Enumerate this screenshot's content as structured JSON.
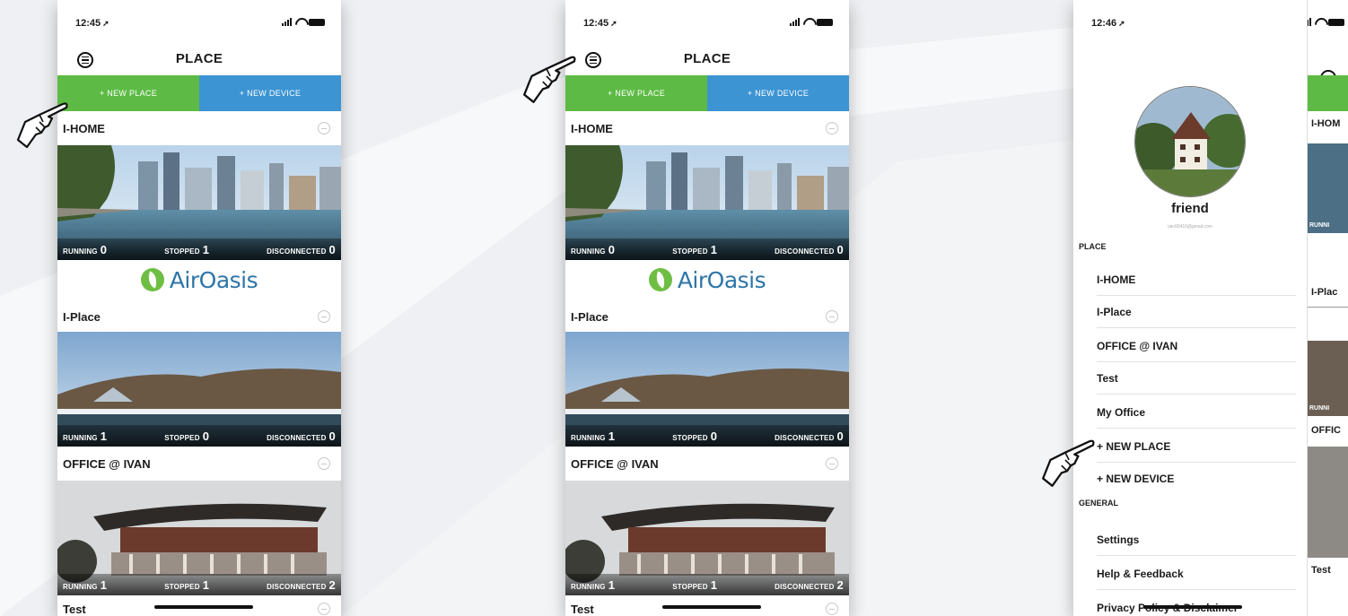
{
  "colors": {
    "green": "#5dbb45",
    "blue": "#3c94d3",
    "logo_blue": "#2e75a8",
    "leaf_green": "#6fbe44"
  },
  "screen1": {
    "time": "12:45",
    "title": "PLACE",
    "new_place": "+ NEW PLACE",
    "new_device": "+ NEW DEVICE",
    "places": [
      {
        "name": "I-HOME",
        "running": "0",
        "stopped": "1",
        "disconnected": "0"
      },
      {
        "name": "I-Place",
        "running": "1",
        "stopped": "0",
        "disconnected": "0"
      },
      {
        "name": "OFFICE @ IVAN",
        "running": "1",
        "stopped": "1",
        "disconnected": "2"
      },
      {
        "name": "Test"
      }
    ],
    "labels": {
      "running": "RUNNING",
      "stopped": "STOPPED",
      "disconnected": "DISCONNECTED"
    },
    "logo": "AirOasis"
  },
  "screen2": {
    "time": "12:45",
    "title": "PLACE",
    "new_place": "+ NEW PLACE",
    "new_device": "+ NEW DEVICE",
    "places": [
      {
        "name": "I-HOME",
        "running": "0",
        "stopped": "1",
        "disconnected": "0"
      },
      {
        "name": "I-Place",
        "running": "1",
        "stopped": "0",
        "disconnected": "0"
      },
      {
        "name": "OFFICE @ IVAN",
        "running": "1",
        "stopped": "1",
        "disconnected": "2"
      },
      {
        "name": "Test"
      }
    ],
    "labels": {
      "running": "RUNNING",
      "stopped": "STOPPED",
      "disconnected": "DISCONNECTED"
    },
    "logo": "AirOasis"
  },
  "screen3": {
    "time": "12:46",
    "profile_name": "friend",
    "profile_email": "iain00416@gmail.com",
    "place_header": "PLACE",
    "place_items": [
      "I-HOME",
      "I-Place",
      "OFFICE @ IVAN",
      "Test",
      "My Office",
      "+ NEW PLACE",
      "+ NEW DEVICE"
    ],
    "general_header": "GENERAL",
    "general_items": [
      "Settings",
      "Help & Feedback",
      "Privacy Policy & Disclaimer"
    ],
    "peek": {
      "home": "I-HOM",
      "place": "I-Plac",
      "running": "RUNNI",
      "office": "OFFIC",
      "runn2": "RUNNI",
      "test": "Test"
    }
  }
}
